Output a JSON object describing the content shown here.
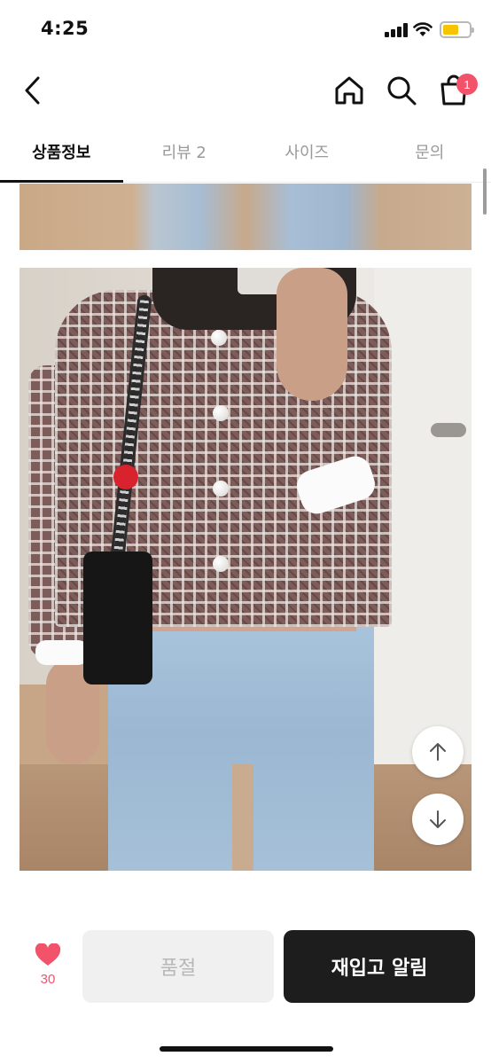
{
  "status_bar": {
    "time": "4:25",
    "battery_color": "#f6c500"
  },
  "nav": {
    "back_icon": "chevron-left-icon",
    "home_icon": "home-icon",
    "search_icon": "search-icon",
    "cart_icon": "shopping-bag-icon",
    "cart_count": "1",
    "badge_color": "#f2526a"
  },
  "tabs": [
    {
      "label": "상품정보",
      "active": true
    },
    {
      "label": "리뷰 2",
      "active": false
    },
    {
      "label": "사이즈",
      "active": false
    },
    {
      "label": "문의",
      "active": false
    }
  ],
  "content": {
    "scroll_up_icon": "arrow-up-icon",
    "scroll_down_icon": "arrow-down-icon"
  },
  "bottom_bar": {
    "like_count": "30",
    "like_icon": "heart-icon",
    "sold_out_label": "품절",
    "restock_label": "재입고 알림",
    "accent": "#f2526a"
  }
}
